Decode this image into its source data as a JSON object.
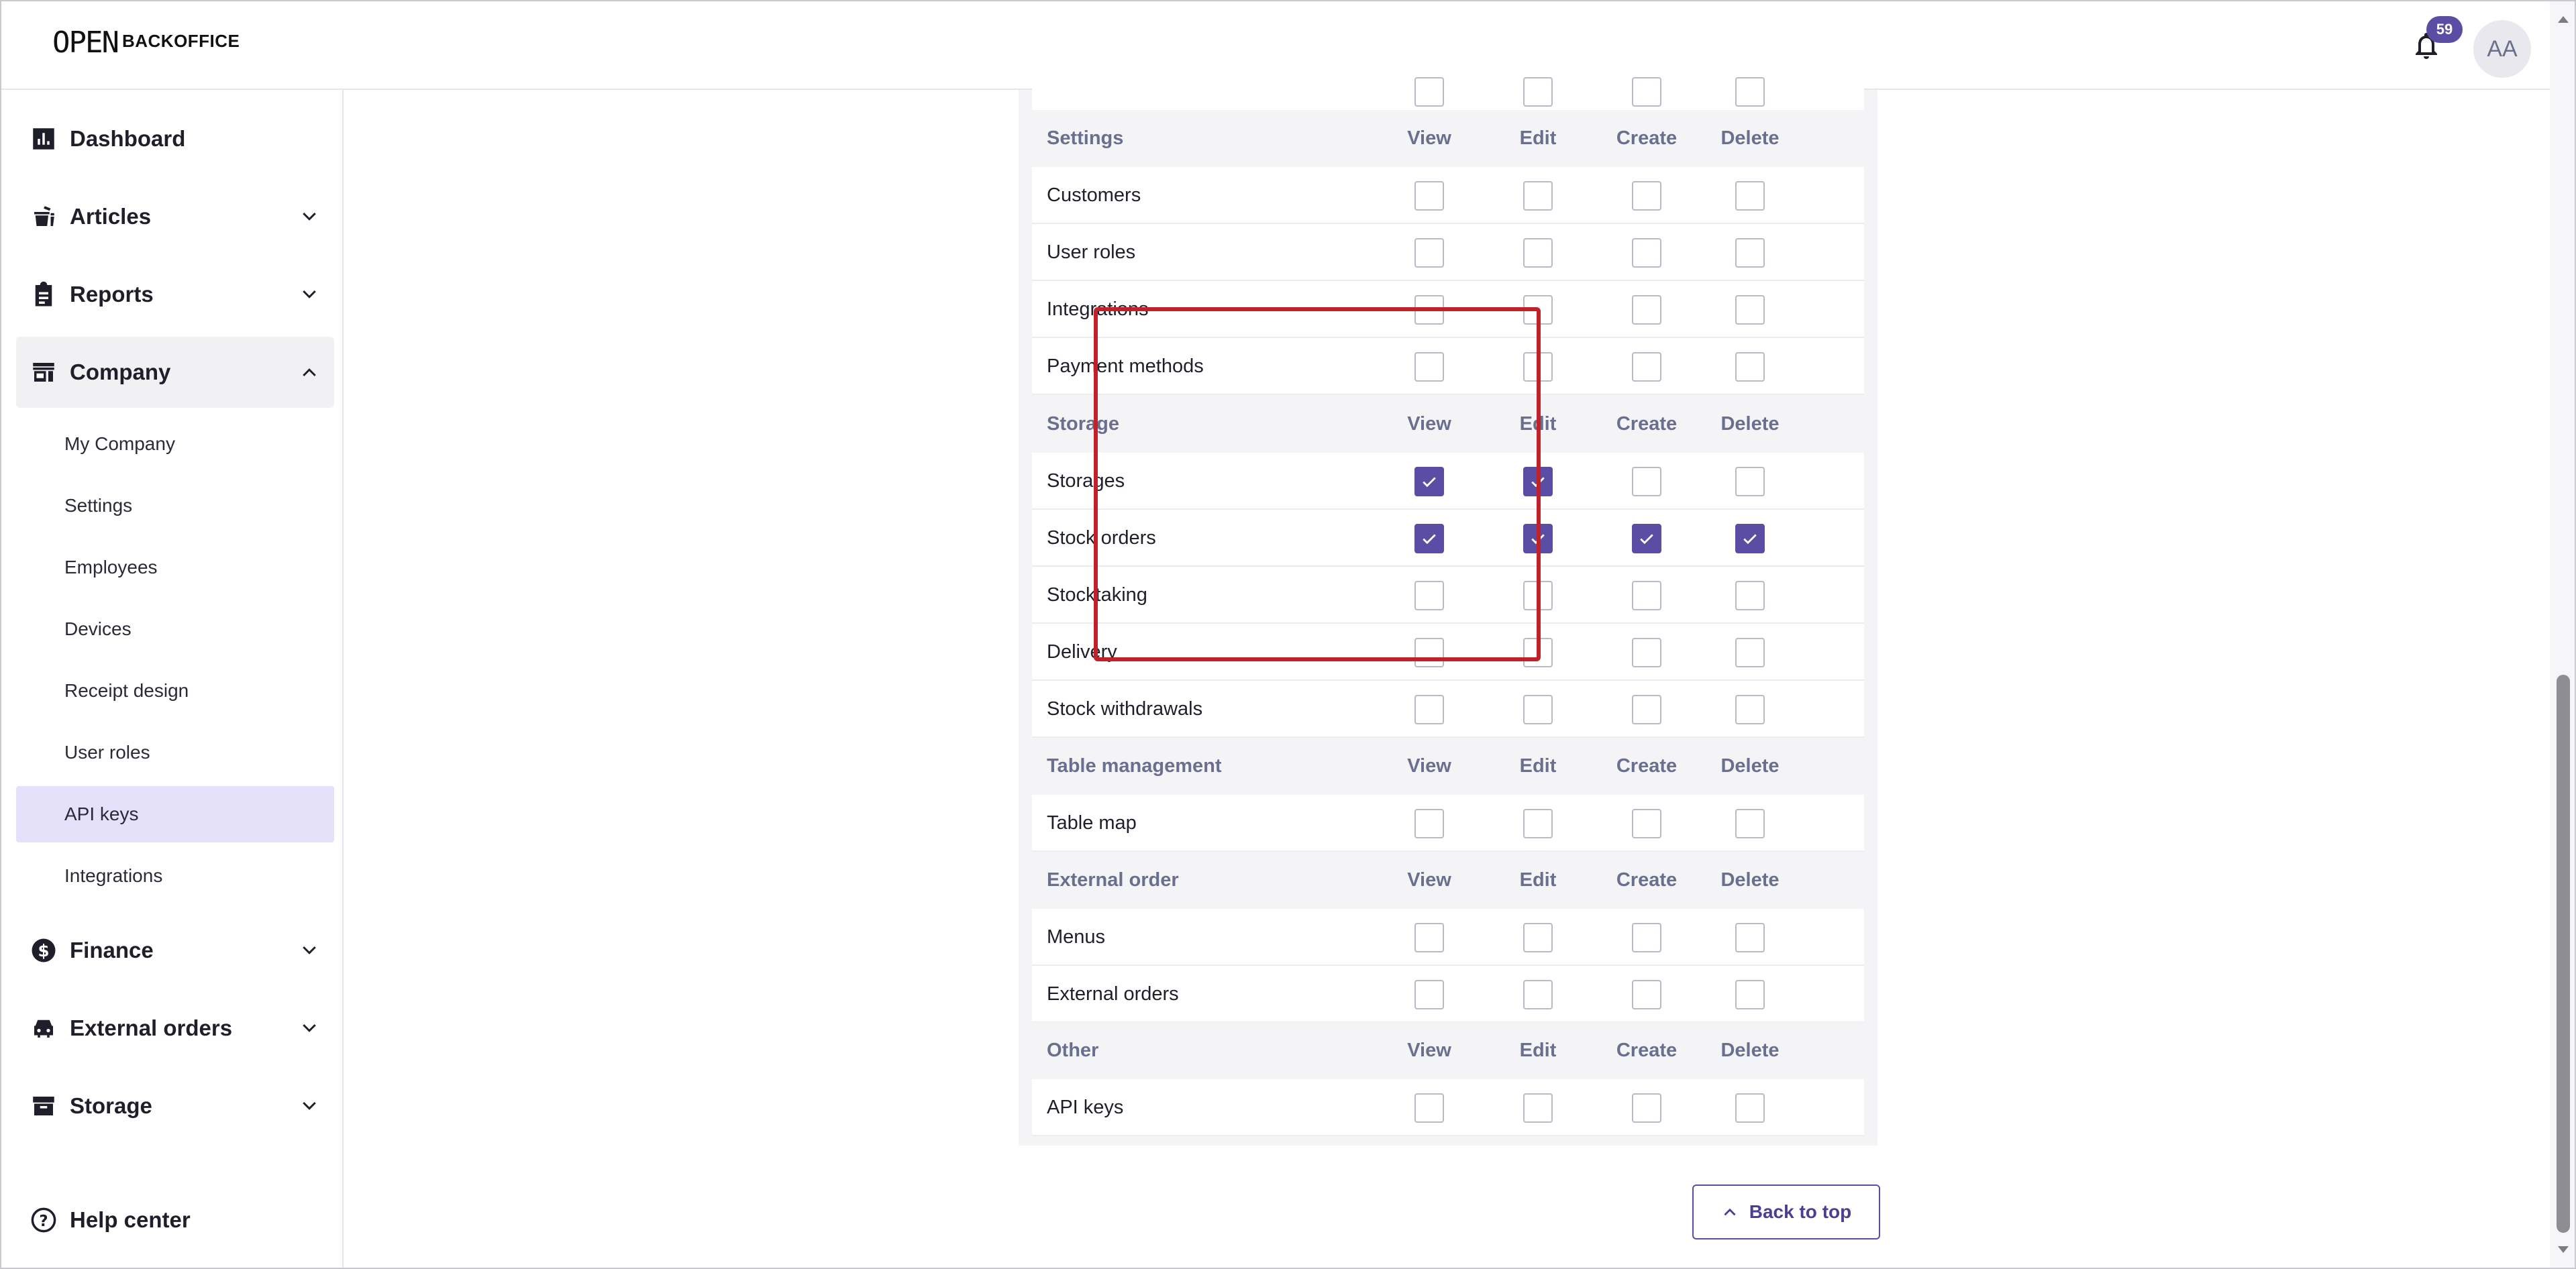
{
  "header": {
    "logo_mark": "OPEN",
    "logo_text": "BACKOFFICE",
    "notification_count": "59",
    "avatar_initials": "AA"
  },
  "sidebar": {
    "items": [
      {
        "label": "Dashboard",
        "icon": "chart-icon"
      },
      {
        "label": "Articles",
        "icon": "articles-icon"
      },
      {
        "label": "Reports",
        "icon": "clipboard-icon"
      },
      {
        "label": "Company",
        "icon": "store-icon"
      },
      {
        "label": "Finance",
        "icon": "dollar-icon"
      },
      {
        "label": "External orders",
        "icon": "car-icon"
      },
      {
        "label": "Storage",
        "icon": "archive-icon"
      }
    ],
    "company_sub": [
      "My Company",
      "Settings",
      "Employees",
      "Devices",
      "Receipt design",
      "User roles",
      "API keys",
      "Integrations"
    ],
    "active_sub": "API keys",
    "help": "Help center"
  },
  "columns": {
    "view": "View",
    "edit": "Edit",
    "create": "Create",
    "delete": "Delete"
  },
  "permissions": {
    "settings": {
      "title": "Settings",
      "rows": [
        {
          "name": "Customers",
          "checks": [
            false,
            false,
            false,
            false
          ]
        },
        {
          "name": "User roles",
          "checks": [
            false,
            false,
            false,
            false
          ]
        },
        {
          "name": "Integrations",
          "checks": [
            false,
            false,
            false,
            false
          ]
        },
        {
          "name": "Payment methods",
          "checks": [
            false,
            false,
            false,
            false
          ]
        }
      ]
    },
    "storage": {
      "title": "Storage",
      "rows": [
        {
          "name": "Storages",
          "checks": [
            true,
            true,
            false,
            false
          ]
        },
        {
          "name": "Stock orders",
          "checks": [
            true,
            true,
            true,
            true
          ]
        },
        {
          "name": "Stocktaking",
          "checks": [
            false,
            false,
            false,
            false
          ]
        },
        {
          "name": "Delivery",
          "checks": [
            false,
            false,
            false,
            false
          ]
        },
        {
          "name": "Stock withdrawals",
          "checks": [
            false,
            false,
            false,
            false
          ]
        }
      ]
    },
    "table_management": {
      "title": "Table management",
      "rows": [
        {
          "name": "Table map",
          "checks": [
            false,
            false,
            false,
            false
          ]
        }
      ]
    },
    "external_order": {
      "title": "External order",
      "rows": [
        {
          "name": "Menus",
          "checks": [
            false,
            false,
            false,
            false
          ]
        },
        {
          "name": "External orders",
          "checks": [
            false,
            false,
            false,
            false
          ]
        }
      ]
    },
    "other": {
      "title": "Other",
      "rows": [
        {
          "name": "API keys",
          "checks": [
            false,
            false,
            false,
            false
          ]
        }
      ]
    }
  },
  "back_to_top": "Back to top",
  "colors": {
    "accent": "#5b4da3",
    "highlight": "#c1222a",
    "active_bg": "#e6e1fb"
  }
}
